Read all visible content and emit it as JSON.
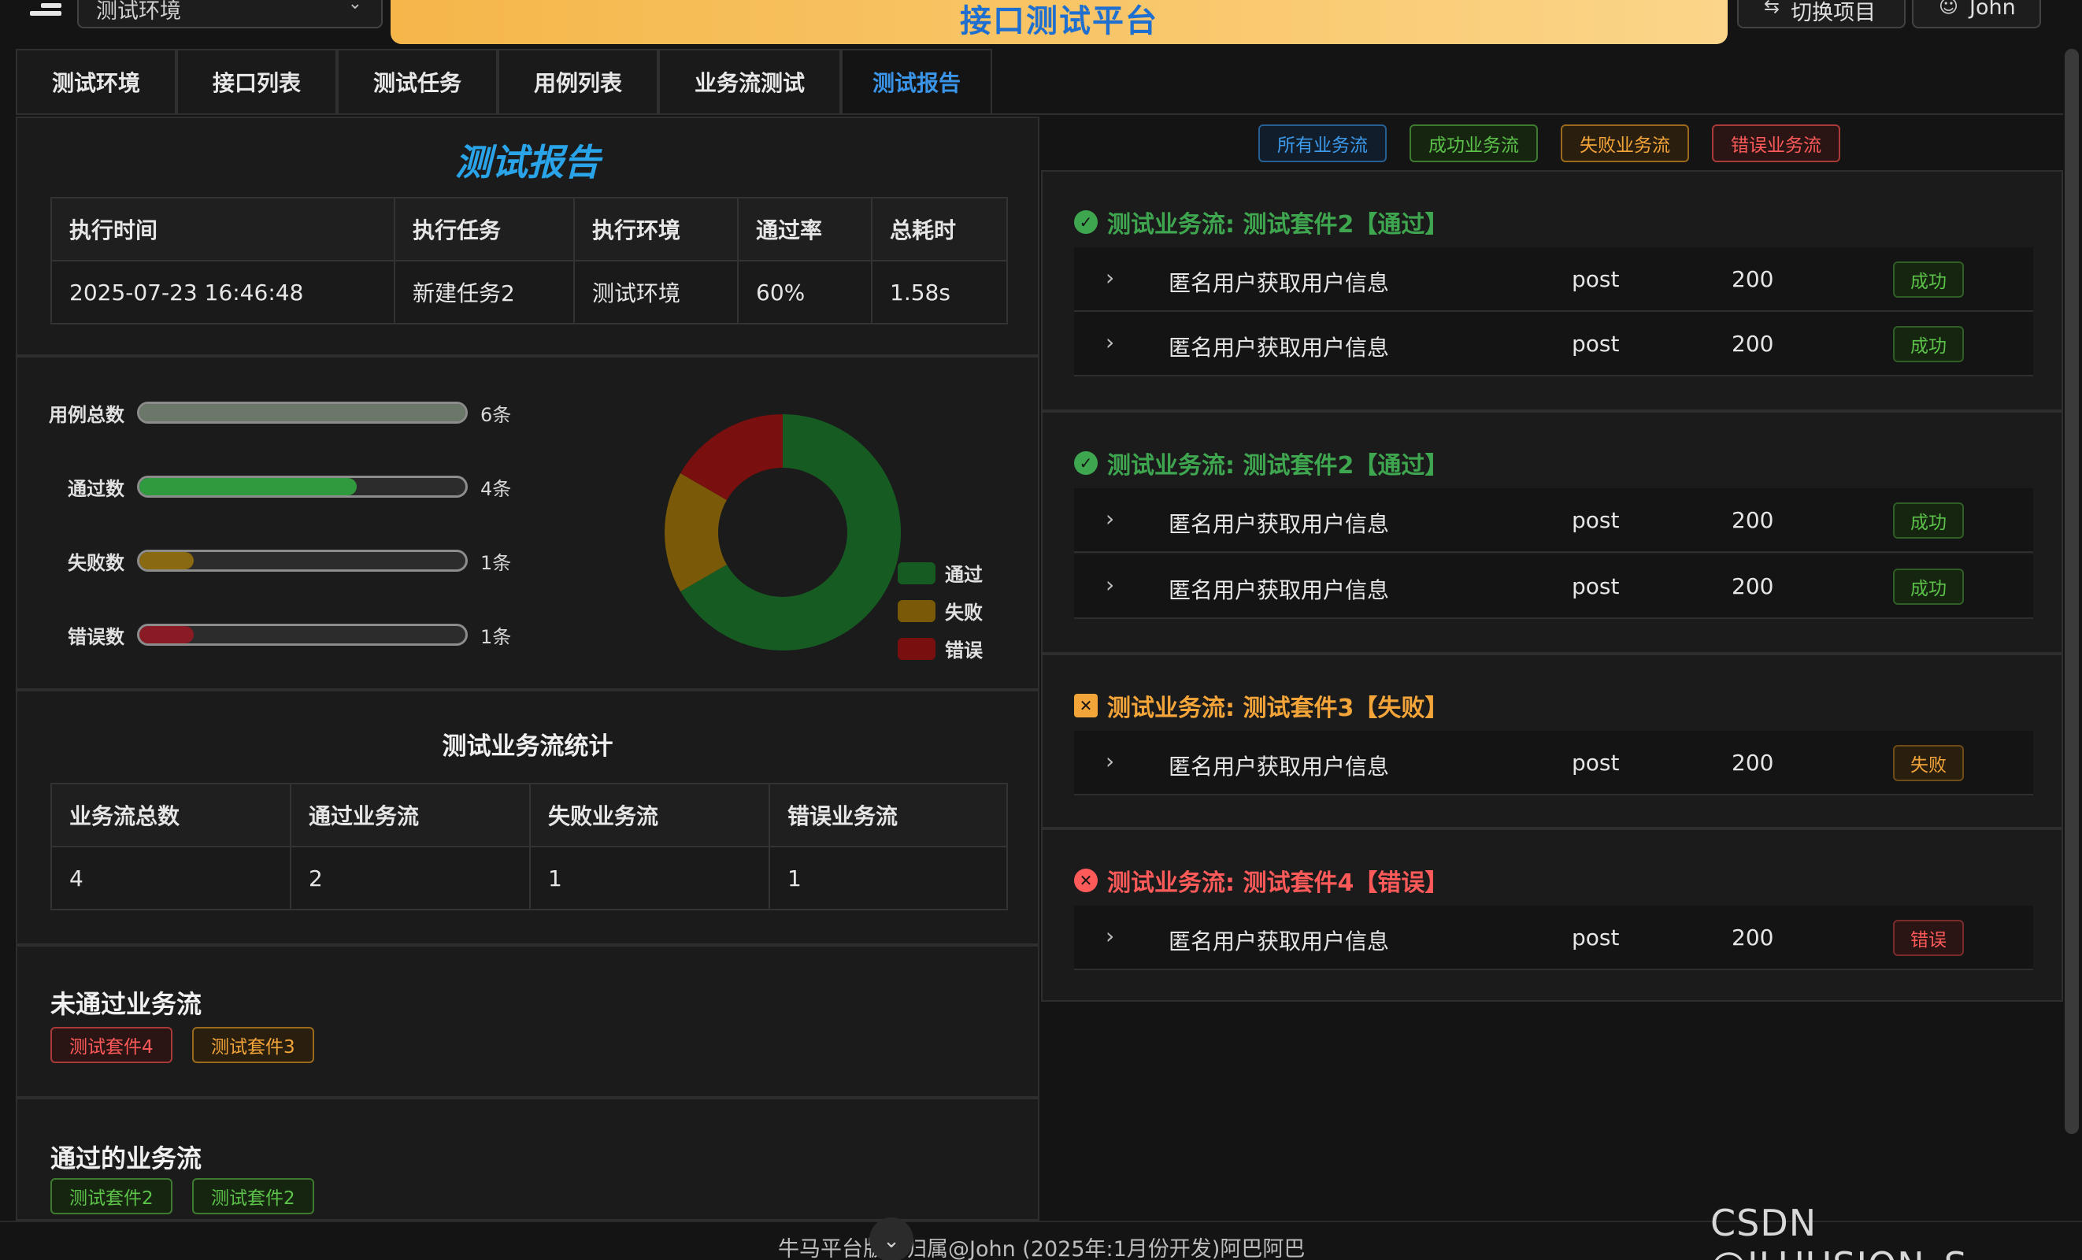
{
  "header": {
    "env_select": "测试环境",
    "platform_title": "接口测试平台",
    "switch_project": "切换项目",
    "user": "John"
  },
  "tabs": [
    "测试环境",
    "接口列表",
    "测试任务",
    "用例列表",
    "业务流测试",
    "测试报告"
  ],
  "active_tab": "测试报告",
  "report": {
    "title": "测试报告",
    "summary_headers": [
      "执行时间",
      "执行任务",
      "执行环境",
      "通过率",
      "总耗时"
    ],
    "summary_values": [
      "2025-07-23 16:46:48",
      "新建任务2",
      "测试环境",
      "60%",
      "1.58s"
    ]
  },
  "progress": [
    {
      "label": "用例总数",
      "count": "6条",
      "fraction": 1.0,
      "color": "#6b7768"
    },
    {
      "label": "通过数",
      "count": "4条",
      "fraction": 0.667,
      "color": "#2f9a3e"
    },
    {
      "label": "失败数",
      "count": "1条",
      "fraction": 0.167,
      "color": "#8a6a10"
    },
    {
      "label": "错误数",
      "count": "1条",
      "fraction": 0.167,
      "color": "#8a1a24"
    }
  ],
  "chart_data": {
    "type": "pie",
    "donut": true,
    "categories": [
      "通过",
      "失败",
      "错误"
    ],
    "values": [
      4,
      1,
      1
    ],
    "colors": [
      "#165c22",
      "#7a5a08",
      "#7a0f0f"
    ],
    "legend_position": "right"
  },
  "flow_stats": {
    "title": "测试业务流统计",
    "headers": [
      "业务流总数",
      "通过业务流",
      "失败业务流",
      "错误业务流"
    ],
    "values": [
      "4",
      "2",
      "1",
      "1"
    ]
  },
  "failed_flows": {
    "title": "未通过业务流",
    "items": [
      "测试套件4",
      "测试套件3"
    ]
  },
  "passed_flows": {
    "title": "通过的业务流",
    "items": [
      "测试套件2",
      "测试套件2"
    ]
  },
  "filters": [
    "所有业务流",
    "成功业务流",
    "失败业务流",
    "错误业务流"
  ],
  "flows": [
    {
      "title": "测试业务流: 测试套件2【通过】",
      "status": "pass",
      "color": "#3fa650",
      "rows": [
        {
          "name": "匿名用户获取用户信息",
          "method": "post",
          "code": "200",
          "result": "成功"
        },
        {
          "name": "匿名用户获取用户信息",
          "method": "post",
          "code": "200",
          "result": "成功"
        }
      ]
    },
    {
      "title": "测试业务流: 测试套件2【通过】",
      "status": "pass",
      "color": "#3fa650",
      "rows": [
        {
          "name": "匿名用户获取用户信息",
          "method": "post",
          "code": "200",
          "result": "成功"
        },
        {
          "name": "匿名用户获取用户信息",
          "method": "post",
          "code": "200",
          "result": "成功"
        }
      ]
    },
    {
      "title": "测试业务流: 测试套件3【失败】",
      "status": "fail",
      "color": "#f4a53a",
      "rows": [
        {
          "name": "匿名用户获取用户信息",
          "method": "post",
          "code": "200",
          "result": "失败"
        }
      ]
    },
    {
      "title": "测试业务流: 测试套件4【错误】",
      "status": "error",
      "color": "#ff5a5a",
      "rows": [
        {
          "name": "匿名用户获取用户信息",
          "method": "post",
          "code": "200",
          "result": "错误"
        }
      ]
    }
  ],
  "footer": "牛马平台版权归属@John (2025年:1月份开发)阿巴阿巴",
  "watermark": "CSDN @ILUUSION_S"
}
